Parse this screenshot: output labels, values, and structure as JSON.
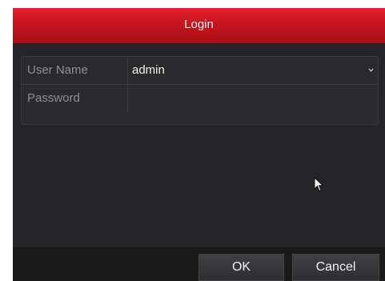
{
  "dialog": {
    "title": "Login"
  },
  "form": {
    "username": {
      "label": "User Name",
      "value": "admin",
      "icon": "chevron-down-icon"
    },
    "password": {
      "label": "Password",
      "value": ""
    }
  },
  "buttons": {
    "ok_label": "OK",
    "cancel_label": "Cancel"
  },
  "colors": {
    "title_bar": "#c8141f",
    "dialog_background": "#252527",
    "text": "#f0f0f0",
    "label_text": "#8f8f93"
  },
  "pointer": {
    "icon": "mouse-pointer-icon"
  }
}
